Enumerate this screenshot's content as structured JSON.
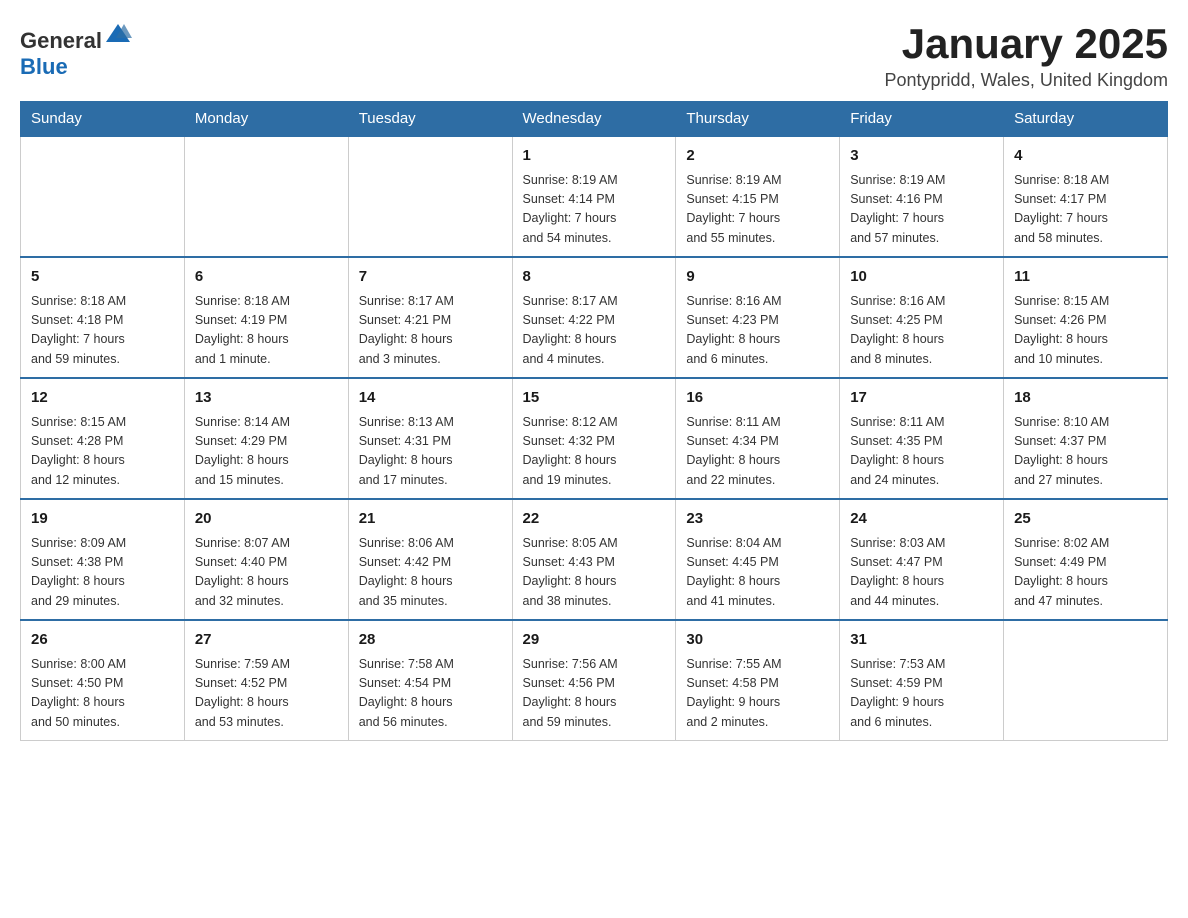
{
  "header": {
    "logo_general": "General",
    "logo_blue": "Blue",
    "month_title": "January 2025",
    "location": "Pontypridd, Wales, United Kingdom"
  },
  "weekdays": [
    "Sunday",
    "Monday",
    "Tuesday",
    "Wednesday",
    "Thursday",
    "Friday",
    "Saturday"
  ],
  "weeks": [
    [
      {
        "day": "",
        "info": ""
      },
      {
        "day": "",
        "info": ""
      },
      {
        "day": "",
        "info": ""
      },
      {
        "day": "1",
        "info": "Sunrise: 8:19 AM\nSunset: 4:14 PM\nDaylight: 7 hours\nand 54 minutes."
      },
      {
        "day": "2",
        "info": "Sunrise: 8:19 AM\nSunset: 4:15 PM\nDaylight: 7 hours\nand 55 minutes."
      },
      {
        "day": "3",
        "info": "Sunrise: 8:19 AM\nSunset: 4:16 PM\nDaylight: 7 hours\nand 57 minutes."
      },
      {
        "day": "4",
        "info": "Sunrise: 8:18 AM\nSunset: 4:17 PM\nDaylight: 7 hours\nand 58 minutes."
      }
    ],
    [
      {
        "day": "5",
        "info": "Sunrise: 8:18 AM\nSunset: 4:18 PM\nDaylight: 7 hours\nand 59 minutes."
      },
      {
        "day": "6",
        "info": "Sunrise: 8:18 AM\nSunset: 4:19 PM\nDaylight: 8 hours\nand 1 minute."
      },
      {
        "day": "7",
        "info": "Sunrise: 8:17 AM\nSunset: 4:21 PM\nDaylight: 8 hours\nand 3 minutes."
      },
      {
        "day": "8",
        "info": "Sunrise: 8:17 AM\nSunset: 4:22 PM\nDaylight: 8 hours\nand 4 minutes."
      },
      {
        "day": "9",
        "info": "Sunrise: 8:16 AM\nSunset: 4:23 PM\nDaylight: 8 hours\nand 6 minutes."
      },
      {
        "day": "10",
        "info": "Sunrise: 8:16 AM\nSunset: 4:25 PM\nDaylight: 8 hours\nand 8 minutes."
      },
      {
        "day": "11",
        "info": "Sunrise: 8:15 AM\nSunset: 4:26 PM\nDaylight: 8 hours\nand 10 minutes."
      }
    ],
    [
      {
        "day": "12",
        "info": "Sunrise: 8:15 AM\nSunset: 4:28 PM\nDaylight: 8 hours\nand 12 minutes."
      },
      {
        "day": "13",
        "info": "Sunrise: 8:14 AM\nSunset: 4:29 PM\nDaylight: 8 hours\nand 15 minutes."
      },
      {
        "day": "14",
        "info": "Sunrise: 8:13 AM\nSunset: 4:31 PM\nDaylight: 8 hours\nand 17 minutes."
      },
      {
        "day": "15",
        "info": "Sunrise: 8:12 AM\nSunset: 4:32 PM\nDaylight: 8 hours\nand 19 minutes."
      },
      {
        "day": "16",
        "info": "Sunrise: 8:11 AM\nSunset: 4:34 PM\nDaylight: 8 hours\nand 22 minutes."
      },
      {
        "day": "17",
        "info": "Sunrise: 8:11 AM\nSunset: 4:35 PM\nDaylight: 8 hours\nand 24 minutes."
      },
      {
        "day": "18",
        "info": "Sunrise: 8:10 AM\nSunset: 4:37 PM\nDaylight: 8 hours\nand 27 minutes."
      }
    ],
    [
      {
        "day": "19",
        "info": "Sunrise: 8:09 AM\nSunset: 4:38 PM\nDaylight: 8 hours\nand 29 minutes."
      },
      {
        "day": "20",
        "info": "Sunrise: 8:07 AM\nSunset: 4:40 PM\nDaylight: 8 hours\nand 32 minutes."
      },
      {
        "day": "21",
        "info": "Sunrise: 8:06 AM\nSunset: 4:42 PM\nDaylight: 8 hours\nand 35 minutes."
      },
      {
        "day": "22",
        "info": "Sunrise: 8:05 AM\nSunset: 4:43 PM\nDaylight: 8 hours\nand 38 minutes."
      },
      {
        "day": "23",
        "info": "Sunrise: 8:04 AM\nSunset: 4:45 PM\nDaylight: 8 hours\nand 41 minutes."
      },
      {
        "day": "24",
        "info": "Sunrise: 8:03 AM\nSunset: 4:47 PM\nDaylight: 8 hours\nand 44 minutes."
      },
      {
        "day": "25",
        "info": "Sunrise: 8:02 AM\nSunset: 4:49 PM\nDaylight: 8 hours\nand 47 minutes."
      }
    ],
    [
      {
        "day": "26",
        "info": "Sunrise: 8:00 AM\nSunset: 4:50 PM\nDaylight: 8 hours\nand 50 minutes."
      },
      {
        "day": "27",
        "info": "Sunrise: 7:59 AM\nSunset: 4:52 PM\nDaylight: 8 hours\nand 53 minutes."
      },
      {
        "day": "28",
        "info": "Sunrise: 7:58 AM\nSunset: 4:54 PM\nDaylight: 8 hours\nand 56 minutes."
      },
      {
        "day": "29",
        "info": "Sunrise: 7:56 AM\nSunset: 4:56 PM\nDaylight: 8 hours\nand 59 minutes."
      },
      {
        "day": "30",
        "info": "Sunrise: 7:55 AM\nSunset: 4:58 PM\nDaylight: 9 hours\nand 2 minutes."
      },
      {
        "day": "31",
        "info": "Sunrise: 7:53 AM\nSunset: 4:59 PM\nDaylight: 9 hours\nand 6 minutes."
      },
      {
        "day": "",
        "info": ""
      }
    ]
  ]
}
